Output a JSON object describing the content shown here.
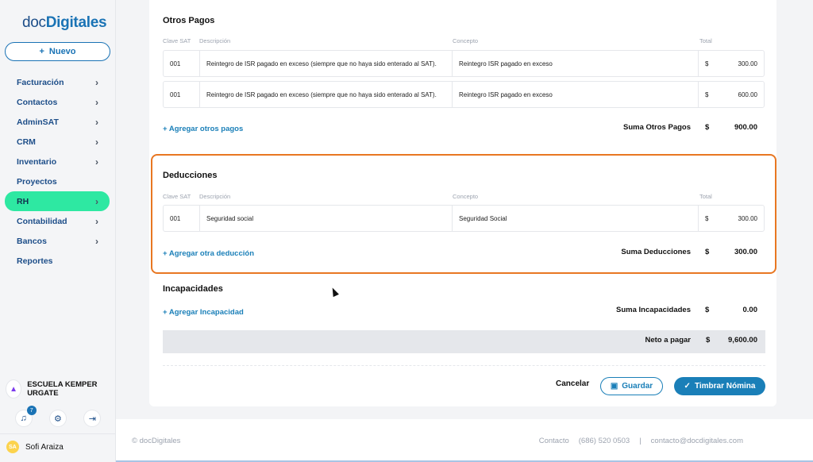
{
  "brand": {
    "prefix": "doc",
    "name": "Digitales"
  },
  "sidebar": {
    "new_button": "Nuevo",
    "items": [
      {
        "label": "Facturación",
        "chevron": true
      },
      {
        "label": "Contactos",
        "chevron": true
      },
      {
        "label": "AdminSAT",
        "chevron": true
      },
      {
        "label": "CRM",
        "chevron": true
      },
      {
        "label": "Inventario",
        "chevron": true
      },
      {
        "label": "Proyectos",
        "chevron": false
      },
      {
        "label": "RH",
        "chevron": true,
        "active": true
      },
      {
        "label": "Contabilidad",
        "chevron": true
      },
      {
        "label": "Bancos",
        "chevron": true
      },
      {
        "label": "Reportes",
        "chevron": false
      }
    ],
    "org_name": "ESCUELA KEMPER URGATE",
    "notifications_count": "7",
    "user": {
      "initials": "SA",
      "name": "Sofi Araiza"
    }
  },
  "columns": {
    "clave": "Clave SAT",
    "descripcion": "Descripción",
    "concepto": "Concepto",
    "total": "Total"
  },
  "otros_pagos": {
    "title": "Otros Pagos",
    "rows": [
      {
        "clave": "001",
        "descripcion": "Reintegro de ISR pagado en exceso (siempre que no haya sido enterado al SAT).",
        "concepto": "Reintegro ISR pagado en exceso",
        "currency": "$",
        "total": "300.00"
      },
      {
        "clave": "001",
        "descripcion": "Reintegro de ISR pagado en exceso (siempre que no haya sido enterado al SAT).",
        "concepto": "Reintegro ISR pagado en exceso",
        "currency": "$",
        "total": "600.00"
      }
    ],
    "add_link": "+ Agregar otros pagos",
    "sum_label": "Suma Otros Pagos",
    "sum_currency": "$",
    "sum_value": "900.00"
  },
  "deducciones": {
    "title": "Deducciones",
    "rows": [
      {
        "clave": "001",
        "descripcion": "Seguridad social",
        "concepto": "Seguridad Social",
        "currency": "$",
        "total": "300.00"
      }
    ],
    "add_link": "+ Agregar otra deducción",
    "sum_label": "Suma Deducciones",
    "sum_currency": "$",
    "sum_value": "300.00"
  },
  "incapacidades": {
    "title": "Incapacidades",
    "add_link": "+ Agregar Incapacidad",
    "sum_label": "Suma Incapacidades",
    "sum_currency": "$",
    "sum_value": "0.00"
  },
  "neto": {
    "label": "Neto a pagar",
    "currency": "$",
    "value": "9,600.00"
  },
  "actions": {
    "cancel": "Cancelar",
    "save": "Guardar",
    "stamp": "Timbrar Nómina"
  },
  "footer": {
    "copyright": "© docDigitales",
    "contact_label": "Contacto",
    "phone": "(686) 520 0503",
    "separator": "|",
    "email": "contacto@docdigitales.com"
  },
  "colors": {
    "primary": "#1a7fb8",
    "active_nav": "#2ee8a2",
    "highlight": "#e87722"
  }
}
